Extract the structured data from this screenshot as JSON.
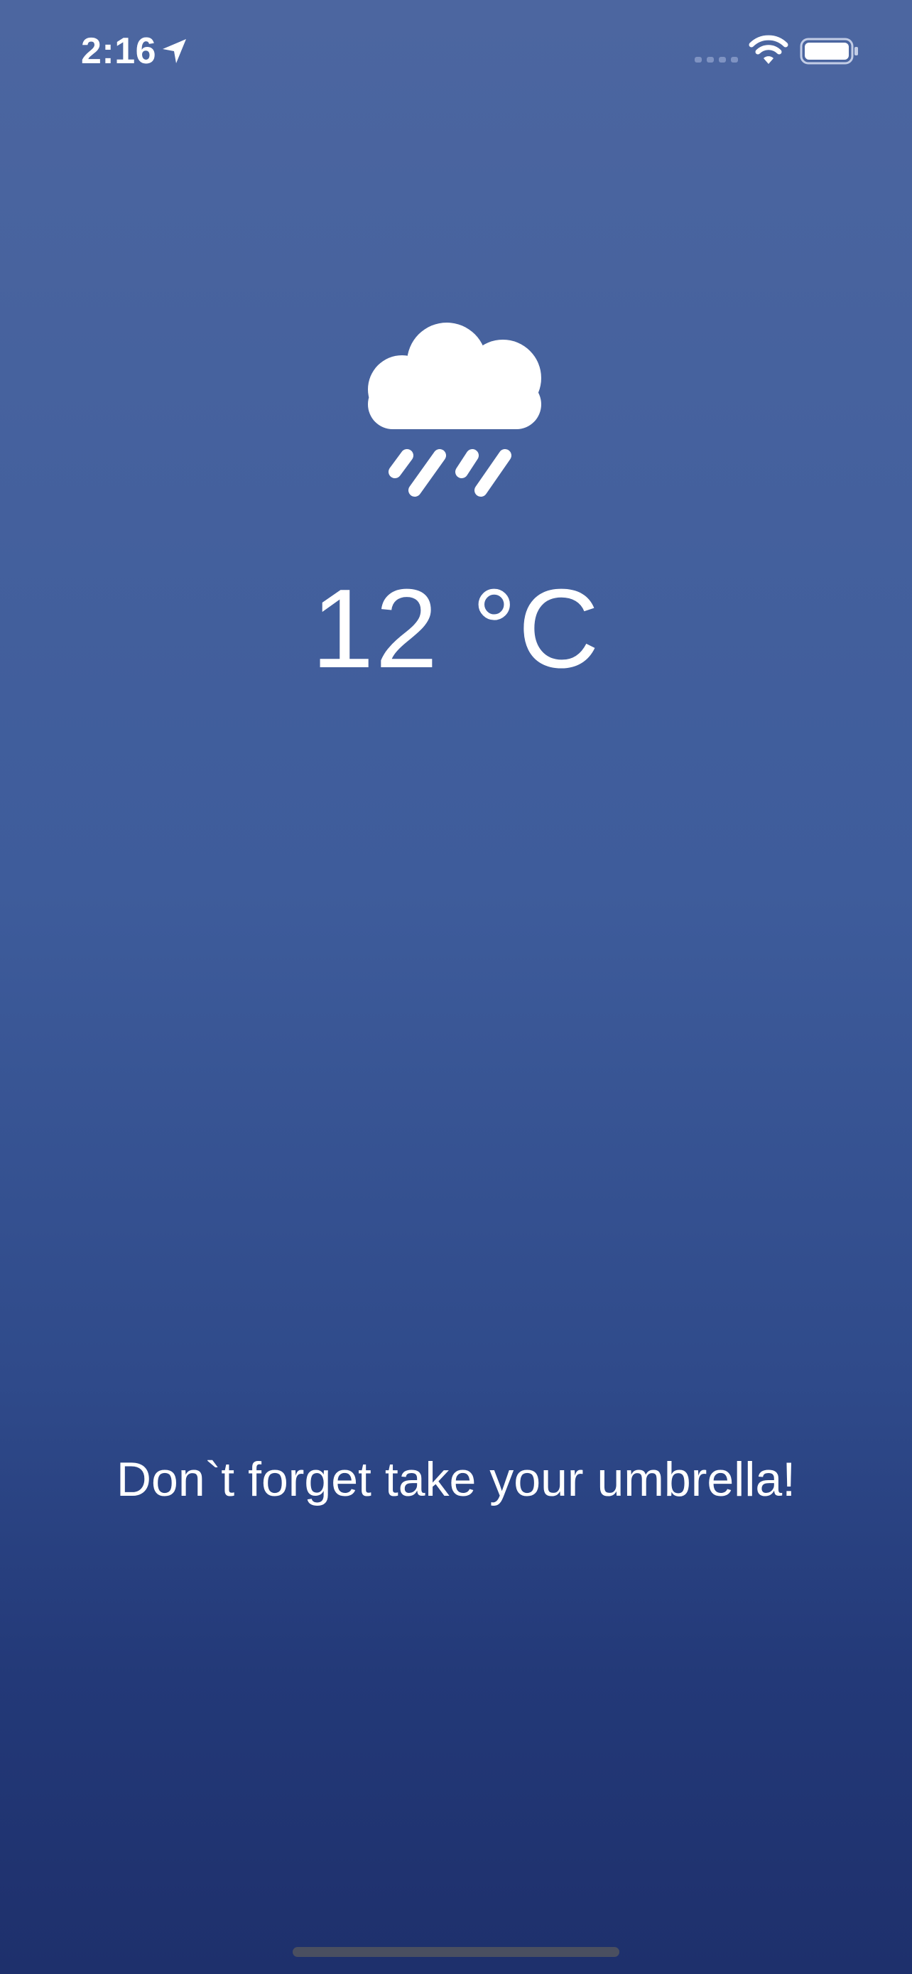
{
  "status_bar": {
    "time": "2:16",
    "location_icon": "location-arrow-icon",
    "signal_icon": "cellular-signal-icon",
    "wifi_icon": "wifi-icon",
    "battery_icon": "battery-icon"
  },
  "weather": {
    "icon": "cloud-rain-icon",
    "temperature": "12 °C",
    "message": "Don`t forget take your umbrella!"
  },
  "colors": {
    "background_top": "#4c66a0",
    "background_bottom": "#1e306c",
    "text": "#ffffff"
  }
}
